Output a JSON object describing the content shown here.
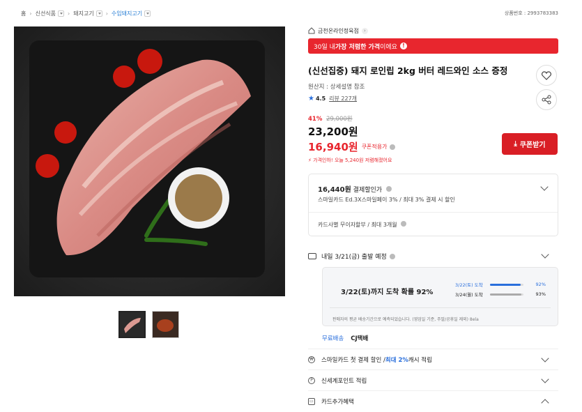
{
  "breadcrumb": {
    "home": "홈",
    "level1": "신선식품",
    "level2": "돼지고기",
    "level3": "수입돼지고기"
  },
  "product_no": "상품번호 : 2993783383",
  "store": {
    "name": "금천온라인정육점"
  },
  "promo": {
    "prefix": "30일 내 ",
    "bold": "가장 저렴한 가격",
    "suffix": "이에요"
  },
  "product": {
    "title": "(신선집중) 돼지 로인립 2kg 버터 레드와인 소스 증정",
    "origin": "원산지 : 상세설명 참조",
    "rating": "4.5",
    "reviews": "리뷰 227개"
  },
  "price": {
    "discount_pct": "41%",
    "original": "29,000원",
    "sale": "23,200원",
    "coupon_price": "16,940원",
    "coupon_label": "쿠폰적용가",
    "price_drop": "가격인하! 오늘 5,240원 저렴해졌어요",
    "coupon_button": "쿠폰받기"
  },
  "payment": {
    "amount": "16,440원",
    "amount_label": "결제할인가",
    "desc": "스마일카드 Ed.3X스마일페이 3% / 최대 3% 결제 시 할인",
    "installment": "카드사별 무이자할부 / 최대 3개월"
  },
  "shipping": {
    "title": "내일 3/21(금) 출발 예정",
    "probability_text": "3/22(토)까지 도착 확률 92%",
    "bars": [
      {
        "day": "3/22(토) 도착",
        "value": 92,
        "label": "92%"
      },
      {
        "day": "3/24(월) 도착",
        "value": 93,
        "label": "93%"
      }
    ],
    "note": "판매자의 평균 배송기간으로 예측되었습니다. (영업일 기준, 주말/공휴일 제외) 8ela",
    "free": "무료배송",
    "carrier": "CJ택배"
  },
  "benefits": [
    {
      "pre": "스마일카드 첫 결제 할인 / ",
      "blue": "최대 2%",
      "post": " 캐시 적립",
      "icon": "coin-icon"
    },
    {
      "pre": "신세계포인트 적립",
      "blue": "",
      "post": "",
      "icon": "point-icon"
    },
    {
      "pre": "카드추가혜택",
      "blue": "",
      "post": "",
      "icon": "card-icon"
    }
  ]
}
